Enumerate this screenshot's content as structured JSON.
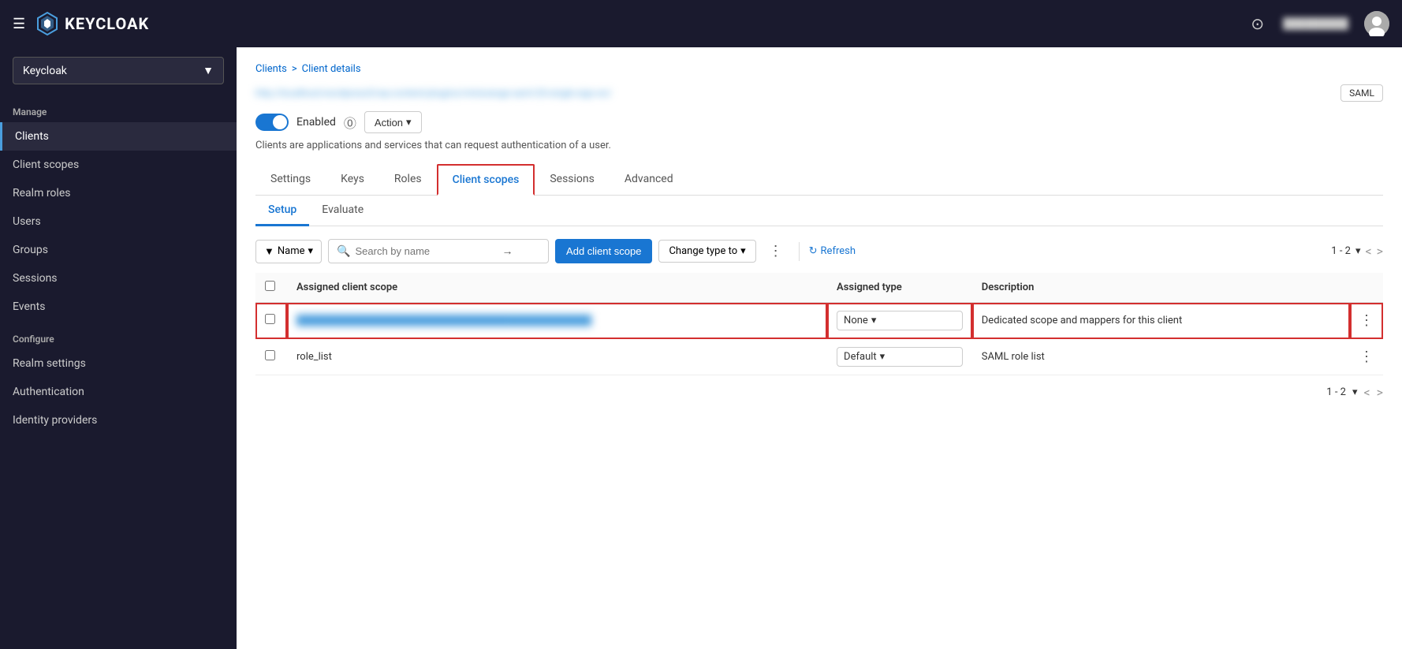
{
  "navbar": {
    "hamburger_icon": "☰",
    "logo_text": "KEYCLOAK",
    "help_icon": "?",
    "user_name": "█████████",
    "avatar_label": "User Avatar"
  },
  "sidebar": {
    "realm_selector": "Keycloak",
    "manage_label": "Manage",
    "items_manage": [
      {
        "id": "clients",
        "label": "Clients",
        "active": true
      },
      {
        "id": "client-scopes",
        "label": "Client scopes"
      },
      {
        "id": "realm-roles",
        "label": "Realm roles"
      },
      {
        "id": "users",
        "label": "Users"
      },
      {
        "id": "groups",
        "label": "Groups"
      },
      {
        "id": "sessions",
        "label": "Sessions"
      },
      {
        "id": "events",
        "label": "Events"
      }
    ],
    "configure_label": "Configure",
    "items_configure": [
      {
        "id": "realm-settings",
        "label": "Realm settings"
      },
      {
        "id": "authentication",
        "label": "Authentication"
      },
      {
        "id": "identity-providers",
        "label": "Identity providers"
      }
    ]
  },
  "breadcrumb": {
    "parent": "Clients",
    "separator": ">",
    "current": "Client details"
  },
  "client": {
    "url": "http://localhost/wordpress5/wp-content/plugins/miniorange-saml-20-single-sign-on/",
    "badge": "SAML",
    "enabled_label": "Enabled",
    "action_label": "Action",
    "description": "Clients are applications and services that can request authentication of a user."
  },
  "tabs": [
    {
      "id": "settings",
      "label": "Settings"
    },
    {
      "id": "keys",
      "label": "Keys"
    },
    {
      "id": "roles",
      "label": "Roles"
    },
    {
      "id": "client-scopes",
      "label": "Client scopes",
      "active": true
    },
    {
      "id": "sessions",
      "label": "Sessions"
    },
    {
      "id": "advanced",
      "label": "Advanced"
    }
  ],
  "sub_tabs": [
    {
      "id": "setup",
      "label": "Setup",
      "active": true
    },
    {
      "id": "evaluate",
      "label": "Evaluate"
    }
  ],
  "toolbar": {
    "filter_label": "Name",
    "search_placeholder": "Search by name",
    "add_scope_label": "Add client scope",
    "change_type_label": "Change type to",
    "refresh_label": "Refresh",
    "pagination_label": "1 - 2",
    "prev_icon": "<",
    "next_icon": ">"
  },
  "table": {
    "headers": [
      {
        "id": "checkbox",
        "label": ""
      },
      {
        "id": "assigned-scope",
        "label": "Assigned client scope"
      },
      {
        "id": "assigned-type",
        "label": "Assigned type"
      },
      {
        "id": "description",
        "label": "Description"
      },
      {
        "id": "actions",
        "label": ""
      }
    ],
    "rows": [
      {
        "id": "row1",
        "name": "http://localhost/wordpress5/wp-content/plugins/miniorange-saml-20-single-sign-on/dedicated",
        "name_display": "████████████████████████████████████████████",
        "type": "None",
        "description": "Dedicated scope and mappers for this client",
        "highlighted": true
      },
      {
        "id": "row2",
        "name": "role_list",
        "name_display": "role_list",
        "type": "Default",
        "description": "SAML role list",
        "highlighted": false
      }
    ]
  },
  "pagination_bottom": {
    "label": "1 - 2"
  }
}
